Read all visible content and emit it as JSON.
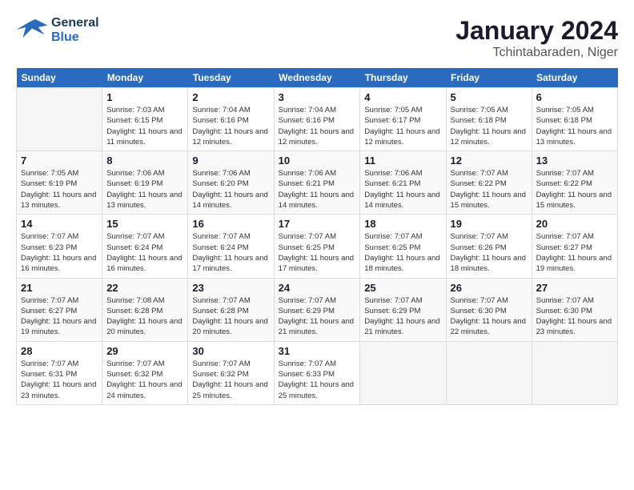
{
  "header": {
    "logo_general": "General",
    "logo_blue": "Blue",
    "title": "January 2024",
    "subtitle": "Tchintabaraden, Niger"
  },
  "days_of_week": [
    "Sunday",
    "Monday",
    "Tuesday",
    "Wednesday",
    "Thursday",
    "Friday",
    "Saturday"
  ],
  "weeks": [
    [
      {
        "num": "",
        "sunrise": "",
        "sunset": "",
        "daylight": ""
      },
      {
        "num": "1",
        "sunrise": "Sunrise: 7:03 AM",
        "sunset": "Sunset: 6:15 PM",
        "daylight": "Daylight: 11 hours and 11 minutes."
      },
      {
        "num": "2",
        "sunrise": "Sunrise: 7:04 AM",
        "sunset": "Sunset: 6:16 PM",
        "daylight": "Daylight: 11 hours and 12 minutes."
      },
      {
        "num": "3",
        "sunrise": "Sunrise: 7:04 AM",
        "sunset": "Sunset: 6:16 PM",
        "daylight": "Daylight: 11 hours and 12 minutes."
      },
      {
        "num": "4",
        "sunrise": "Sunrise: 7:05 AM",
        "sunset": "Sunset: 6:17 PM",
        "daylight": "Daylight: 11 hours and 12 minutes."
      },
      {
        "num": "5",
        "sunrise": "Sunrise: 7:05 AM",
        "sunset": "Sunset: 6:18 PM",
        "daylight": "Daylight: 11 hours and 12 minutes."
      },
      {
        "num": "6",
        "sunrise": "Sunrise: 7:05 AM",
        "sunset": "Sunset: 6:18 PM",
        "daylight": "Daylight: 11 hours and 13 minutes."
      }
    ],
    [
      {
        "num": "7",
        "sunrise": "Sunrise: 7:05 AM",
        "sunset": "Sunset: 6:19 PM",
        "daylight": "Daylight: 11 hours and 13 minutes."
      },
      {
        "num": "8",
        "sunrise": "Sunrise: 7:06 AM",
        "sunset": "Sunset: 6:19 PM",
        "daylight": "Daylight: 11 hours and 13 minutes."
      },
      {
        "num": "9",
        "sunrise": "Sunrise: 7:06 AM",
        "sunset": "Sunset: 6:20 PM",
        "daylight": "Daylight: 11 hours and 14 minutes."
      },
      {
        "num": "10",
        "sunrise": "Sunrise: 7:06 AM",
        "sunset": "Sunset: 6:21 PM",
        "daylight": "Daylight: 11 hours and 14 minutes."
      },
      {
        "num": "11",
        "sunrise": "Sunrise: 7:06 AM",
        "sunset": "Sunset: 6:21 PM",
        "daylight": "Daylight: 11 hours and 14 minutes."
      },
      {
        "num": "12",
        "sunrise": "Sunrise: 7:07 AM",
        "sunset": "Sunset: 6:22 PM",
        "daylight": "Daylight: 11 hours and 15 minutes."
      },
      {
        "num": "13",
        "sunrise": "Sunrise: 7:07 AM",
        "sunset": "Sunset: 6:22 PM",
        "daylight": "Daylight: 11 hours and 15 minutes."
      }
    ],
    [
      {
        "num": "14",
        "sunrise": "Sunrise: 7:07 AM",
        "sunset": "Sunset: 6:23 PM",
        "daylight": "Daylight: 11 hours and 16 minutes."
      },
      {
        "num": "15",
        "sunrise": "Sunrise: 7:07 AM",
        "sunset": "Sunset: 6:24 PM",
        "daylight": "Daylight: 11 hours and 16 minutes."
      },
      {
        "num": "16",
        "sunrise": "Sunrise: 7:07 AM",
        "sunset": "Sunset: 6:24 PM",
        "daylight": "Daylight: 11 hours and 17 minutes."
      },
      {
        "num": "17",
        "sunrise": "Sunrise: 7:07 AM",
        "sunset": "Sunset: 6:25 PM",
        "daylight": "Daylight: 11 hours and 17 minutes."
      },
      {
        "num": "18",
        "sunrise": "Sunrise: 7:07 AM",
        "sunset": "Sunset: 6:25 PM",
        "daylight": "Daylight: 11 hours and 18 minutes."
      },
      {
        "num": "19",
        "sunrise": "Sunrise: 7:07 AM",
        "sunset": "Sunset: 6:26 PM",
        "daylight": "Daylight: 11 hours and 18 minutes."
      },
      {
        "num": "20",
        "sunrise": "Sunrise: 7:07 AM",
        "sunset": "Sunset: 6:27 PM",
        "daylight": "Daylight: 11 hours and 19 minutes."
      }
    ],
    [
      {
        "num": "21",
        "sunrise": "Sunrise: 7:07 AM",
        "sunset": "Sunset: 6:27 PM",
        "daylight": "Daylight: 11 hours and 19 minutes."
      },
      {
        "num": "22",
        "sunrise": "Sunrise: 7:08 AM",
        "sunset": "Sunset: 6:28 PM",
        "daylight": "Daylight: 11 hours and 20 minutes."
      },
      {
        "num": "23",
        "sunrise": "Sunrise: 7:07 AM",
        "sunset": "Sunset: 6:28 PM",
        "daylight": "Daylight: 11 hours and 20 minutes."
      },
      {
        "num": "24",
        "sunrise": "Sunrise: 7:07 AM",
        "sunset": "Sunset: 6:29 PM",
        "daylight": "Daylight: 11 hours and 21 minutes."
      },
      {
        "num": "25",
        "sunrise": "Sunrise: 7:07 AM",
        "sunset": "Sunset: 6:29 PM",
        "daylight": "Daylight: 11 hours and 21 minutes."
      },
      {
        "num": "26",
        "sunrise": "Sunrise: 7:07 AM",
        "sunset": "Sunset: 6:30 PM",
        "daylight": "Daylight: 11 hours and 22 minutes."
      },
      {
        "num": "27",
        "sunrise": "Sunrise: 7:07 AM",
        "sunset": "Sunset: 6:30 PM",
        "daylight": "Daylight: 11 hours and 23 minutes."
      }
    ],
    [
      {
        "num": "28",
        "sunrise": "Sunrise: 7:07 AM",
        "sunset": "Sunset: 6:31 PM",
        "daylight": "Daylight: 11 hours and 23 minutes."
      },
      {
        "num": "29",
        "sunrise": "Sunrise: 7:07 AM",
        "sunset": "Sunset: 6:32 PM",
        "daylight": "Daylight: 11 hours and 24 minutes."
      },
      {
        "num": "30",
        "sunrise": "Sunrise: 7:07 AM",
        "sunset": "Sunset: 6:32 PM",
        "daylight": "Daylight: 11 hours and 25 minutes."
      },
      {
        "num": "31",
        "sunrise": "Sunrise: 7:07 AM",
        "sunset": "Sunset: 6:33 PM",
        "daylight": "Daylight: 11 hours and 25 minutes."
      },
      {
        "num": "",
        "sunrise": "",
        "sunset": "",
        "daylight": ""
      },
      {
        "num": "",
        "sunrise": "",
        "sunset": "",
        "daylight": ""
      },
      {
        "num": "",
        "sunrise": "",
        "sunset": "",
        "daylight": ""
      }
    ]
  ]
}
